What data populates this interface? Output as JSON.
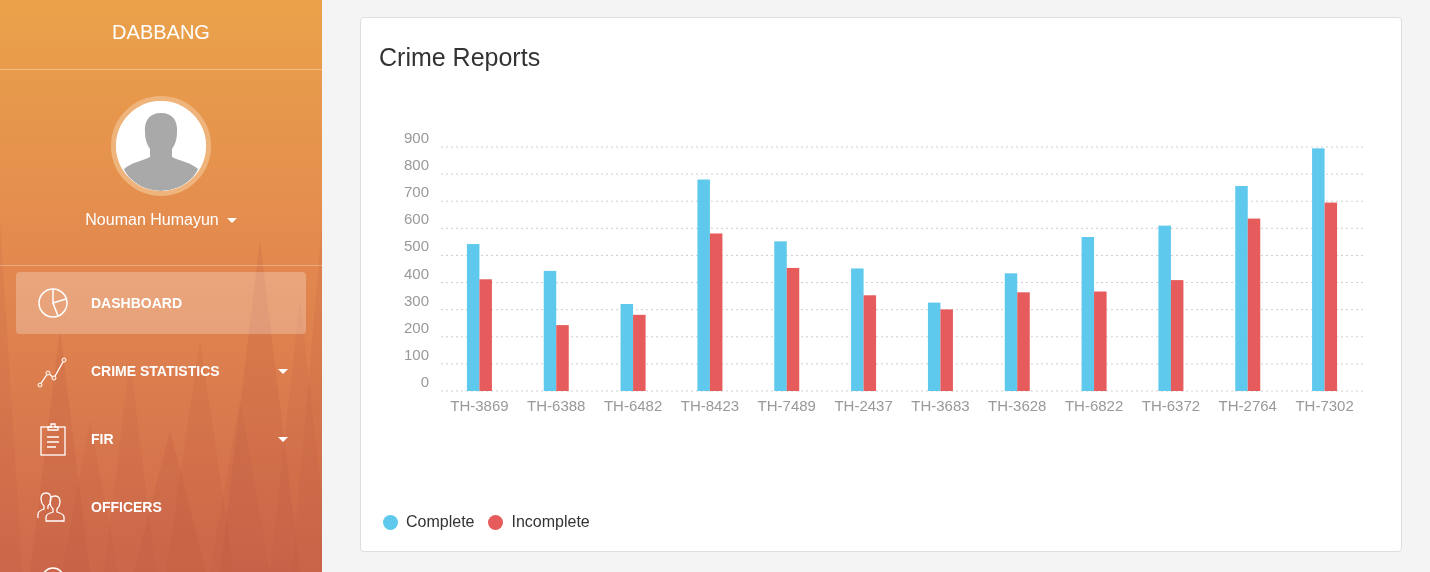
{
  "sidebar": {
    "brand": "DABBANG",
    "user": {
      "name": "Nouman Humayun",
      "has_menu": true
    },
    "menu": [
      {
        "label": "DASHBOARD",
        "selected": true,
        "has_submenu": false
      },
      {
        "label": "CRIME STATISTICS",
        "selected": false,
        "has_submenu": true
      },
      {
        "label": "FIR",
        "selected": false,
        "has_submenu": true
      },
      {
        "label": "OFFICERS",
        "selected": false,
        "has_submenu": false
      }
    ]
  },
  "card": {
    "title": "Crime Reports",
    "chart_data": {
      "type": "bar",
      "categories": [
        "TH-3869",
        "TH-6388",
        "TH-6482",
        "TH-8423",
        "TH-7489",
        "TH-2437",
        "TH-3683",
        "TH-3628",
        "TH-6822",
        "TH-6372",
        "TH-2764",
        "TH-7302"
      ],
      "series": [
        {
          "name": "Complete",
          "color": "#5ec9ec",
          "values": [
            542,
            443,
            321,
            780,
            552,
            452,
            326,
            434,
            568,
            610,
            756,
            895
          ]
        },
        {
          "name": "Incomplete",
          "color": "#e65b5b",
          "values": [
            412,
            243,
            281,
            581,
            454,
            353,
            301,
            364,
            367,
            409,
            636,
            695
          ]
        }
      ],
      "ylim": [
        0,
        900
      ],
      "grid": true,
      "yticks": [
        0,
        100,
        200,
        300,
        400,
        500,
        600,
        700,
        800,
        900
      ]
    }
  }
}
